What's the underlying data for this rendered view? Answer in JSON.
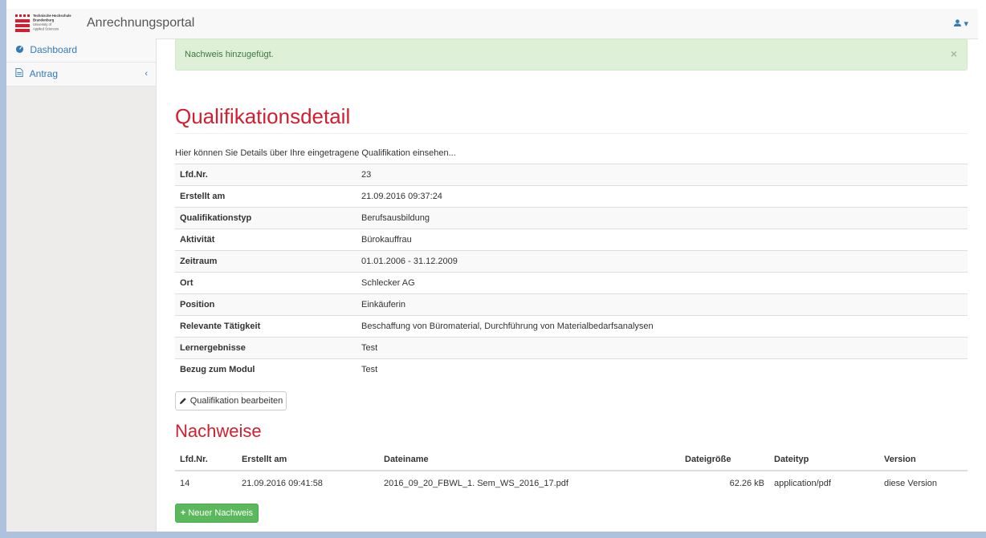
{
  "header": {
    "logo_lines": [
      "Technische Hochschule",
      "Brandenburg",
      "University of",
      "Applied Sciences"
    ],
    "app_title": "Anrechnungsportal",
    "user_icon": "user-icon"
  },
  "sidebar": {
    "items": [
      {
        "label": "Dashboard",
        "icon": "dashboard-icon"
      },
      {
        "label": "Antrag",
        "icon": "document-icon",
        "chevron": "‹"
      }
    ]
  },
  "alert": {
    "message": "Nachweis hinzugefügt.",
    "close": "×"
  },
  "page": {
    "title": "Qualifikationsdetail",
    "intro": "Hier können Sie Details über Ihre eingetragene Qualifikation einsehen...",
    "details": [
      {
        "label": "Lfd.Nr.",
        "value": "23"
      },
      {
        "label": "Erstellt am",
        "value": "21.09.2016 09:37:24"
      },
      {
        "label": "Qualifikationstyp",
        "value": "Berufsausbildung"
      },
      {
        "label": "Aktivität",
        "value": "Bürokauffrau"
      },
      {
        "label": "Zeitraum",
        "value": "01.01.2006 - 31.12.2009"
      },
      {
        "label": "Ort",
        "value": "Schlecker AG"
      },
      {
        "label": "Position",
        "value": "Einkäuferin"
      },
      {
        "label": "Relevante Tätigkeit",
        "value": "Beschaffung von Büromaterial, Durchführung von Materialbedarfsanalysen"
      },
      {
        "label": "Lernergebnisse",
        "value": "Test"
      },
      {
        "label": "Bezug zum Modul",
        "value": "Test"
      }
    ],
    "edit_button": "Qualifikation bearbeiten"
  },
  "nachweise": {
    "title": "Nachweise",
    "columns": [
      "Lfd.Nr.",
      "Erstellt am",
      "Dateiname",
      "Dateigröße",
      "Dateityp",
      "Version"
    ],
    "rows": [
      [
        "14",
        "21.09.2016 09:41:58",
        "2016_09_20_FBWL_1. Sem_WS_2016_17.pdf",
        "62.26 kB",
        "application/pdf",
        "diese Version"
      ]
    ],
    "add_button": "Neuer Nachweis"
  },
  "colors": {
    "accent_red": "#d11f2f",
    "link_blue": "#337ab7",
    "success_green": "#5cb85c"
  }
}
